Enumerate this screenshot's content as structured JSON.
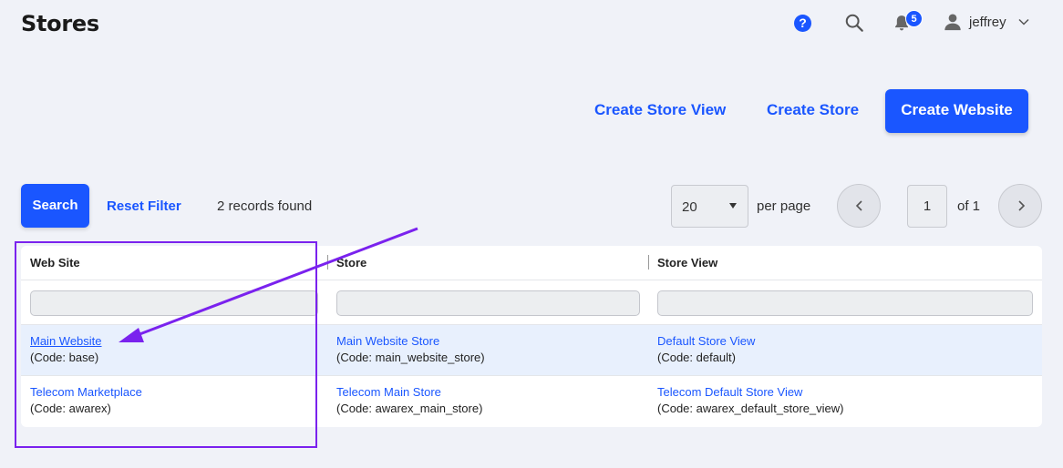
{
  "header": {
    "title": "Stores",
    "help_symbol": "?",
    "notification_count": "5",
    "user_name": "jeffrey"
  },
  "actions": {
    "create_store_view": "Create Store View",
    "create_store": "Create Store",
    "create_website": "Create Website"
  },
  "toolbar": {
    "search_label": "Search",
    "reset_filter_label": "Reset Filter",
    "records_found": "2 records found",
    "per_page_value": "20",
    "per_page_label": "per page",
    "current_page": "1",
    "total_pages_label": "of 1"
  },
  "grid": {
    "columns": [
      "Web Site",
      "Store",
      "Store View"
    ],
    "rows": [
      {
        "website": "Main Website",
        "website_code": "(Code: base)",
        "store": "Main Website Store",
        "store_code": "(Code: main_website_store)",
        "store_view": "Default Store View",
        "store_view_code": "(Code: default)"
      },
      {
        "website": "Telecom Marketplace",
        "website_code": "(Code: awarex)",
        "store": "Telecom Main Store",
        "store_code": "(Code: awarex_main_store)",
        "store_view": "Telecom Default Store View",
        "store_view_code": "(Code: awarex_default_store_view)"
      }
    ]
  },
  "icons": {
    "help": "help-icon",
    "search": "search-icon",
    "notifications": "bell-icon",
    "user": "user-icon",
    "menu": "chevron-down-icon",
    "prev": "chevron-left-icon",
    "next": "chevron-right-icon"
  },
  "colors": {
    "accent": "#1a56ff",
    "annotation": "#7a22ee",
    "row_highlight": "#e8f0fd",
    "background": "#f0f2f8"
  }
}
